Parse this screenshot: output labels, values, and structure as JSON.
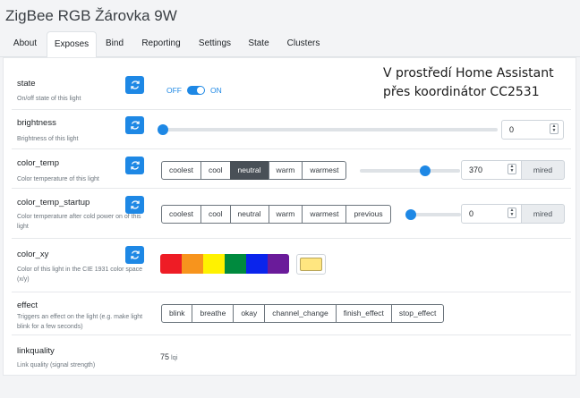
{
  "window": {
    "title": "ZigBee RGB Žárovka 9W"
  },
  "tabs": [
    {
      "label": "About"
    },
    {
      "label": "Exposes"
    },
    {
      "label": "Bind"
    },
    {
      "label": "Reporting"
    },
    {
      "label": "Settings"
    },
    {
      "label": "State"
    },
    {
      "label": "Clusters"
    }
  ],
  "active_tab": "Exposes",
  "overlay_text": "V prostředí Home Assistant přes koordinátor CC2531",
  "colors": {
    "accent": "#1e88e5",
    "selected_button": "#495057"
  },
  "icons": {
    "refresh": "refresh-icon"
  },
  "exposes": {
    "state": {
      "name": "state",
      "description": "On/off state of this light",
      "off_label": "OFF",
      "on_label": "ON",
      "value": "ON"
    },
    "brightness": {
      "name": "brightness",
      "description": "Brightness of this light",
      "value": "0",
      "slider_fraction": 0
    },
    "color_temp": {
      "name": "color_temp",
      "description": "Color temperature of this light",
      "presets": [
        "coolest",
        "cool",
        "neutral",
        "warm",
        "warmest"
      ],
      "selected": "neutral",
      "value": "370",
      "unit": "mired",
      "slider_fraction": 0.65
    },
    "color_temp_startup": {
      "name": "color_temp_startup",
      "description": "Color temperature after cold power on of this light",
      "presets": [
        "coolest",
        "cool",
        "neutral",
        "warm",
        "warmest",
        "previous"
      ],
      "value": "0",
      "unit": "mired",
      "slider_fraction": 0
    },
    "color_xy": {
      "name": "color_xy",
      "description": "Color of this light in the CIE 1931 color space (x/y)",
      "swatches": [
        "#ee1c25",
        "#f7941d",
        "#fff200",
        "#f5e400",
        "#008a3e",
        "#0a24ec",
        "#6a1b9a"
      ],
      "current_color": "#ffe680"
    },
    "effect": {
      "name": "effect",
      "description": "Triggers an effect on the light (e.g. make light blink for a few seconds)",
      "options": [
        "blink",
        "breathe",
        "okay",
        "channel_change",
        "finish_effect",
        "stop_effect"
      ]
    },
    "linkquality": {
      "name": "linkquality",
      "description": "Link quality (signal strength)",
      "value": "75",
      "unit": "lqi"
    }
  }
}
